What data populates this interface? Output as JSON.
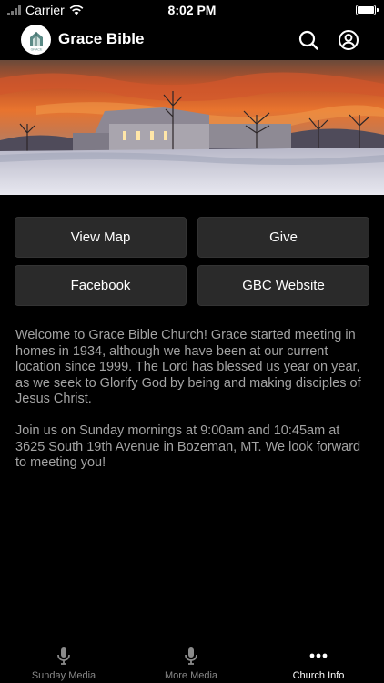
{
  "status_bar": {
    "carrier": "Carrier",
    "time": "8:02 PM"
  },
  "header": {
    "title": "Grace Bible",
    "logo_text": "GRACE",
    "icons": [
      "search-icon",
      "account-icon"
    ]
  },
  "buttons": {
    "view_map": "View Map",
    "give": "Give",
    "facebook": "Facebook",
    "website": "GBC Website"
  },
  "description": {
    "paragraph1": "Welcome to Grace Bible Church!  Grace started meeting in homes in 1934, although we have been at our current location since 1999.  The Lord has blessed us year on year, as we seek to Glorify God by being and making disciples of Jesus Christ.",
    "paragraph2": "Join us on Sunday mornings at 9:00am and 10:45am at 3625 South 19th Avenue in Bozeman, MT. We look forward to meeting you!"
  },
  "tabs": [
    {
      "label": "Sunday Media",
      "icon": "microphone-icon",
      "active": false
    },
    {
      "label": "More Media",
      "icon": "microphone-icon",
      "active": false
    },
    {
      "label": "Church Info",
      "icon": "more-dots-icon",
      "active": true
    }
  ],
  "colors": {
    "background": "#000000",
    "button_bg": "#2a2a2a",
    "body_text": "#a3a3a3",
    "tab_inactive": "#888888",
    "tab_active": "#ffffff"
  }
}
